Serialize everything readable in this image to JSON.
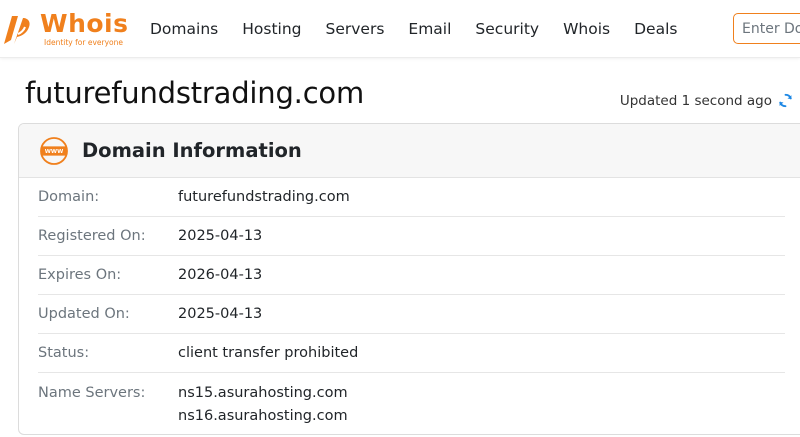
{
  "header": {
    "logo_text": "Whois",
    "logo_tagline": "Identity for everyone",
    "nav": [
      {
        "label": "Domains"
      },
      {
        "label": "Hosting"
      },
      {
        "label": "Servers"
      },
      {
        "label": "Email"
      },
      {
        "label": "Security"
      },
      {
        "label": "Whois"
      },
      {
        "label": "Deals"
      }
    ],
    "search_placeholder": "Enter Do"
  },
  "page": {
    "title": "futurefundstrading.com",
    "updated_text": "Updated 1 second ago",
    "refresh_icon": "refresh-icon"
  },
  "card": {
    "icon": "www-icon",
    "title": "Domain Information",
    "rows": [
      {
        "label": "Domain:",
        "value": "futurefundstrading.com"
      },
      {
        "label": "Registered On:",
        "value": "2025-04-13"
      },
      {
        "label": "Expires On:",
        "value": "2026-04-13"
      },
      {
        "label": "Updated On:",
        "value": "2025-04-13"
      },
      {
        "label": "Status:",
        "value": "client transfer prohibited"
      }
    ],
    "name_servers": {
      "label": "Name Servers:",
      "values": [
        "ns15.asurahosting.com",
        "ns16.asurahosting.com"
      ]
    }
  },
  "colors": {
    "brand": "#f0801d",
    "refresh": "#1e88e5"
  }
}
